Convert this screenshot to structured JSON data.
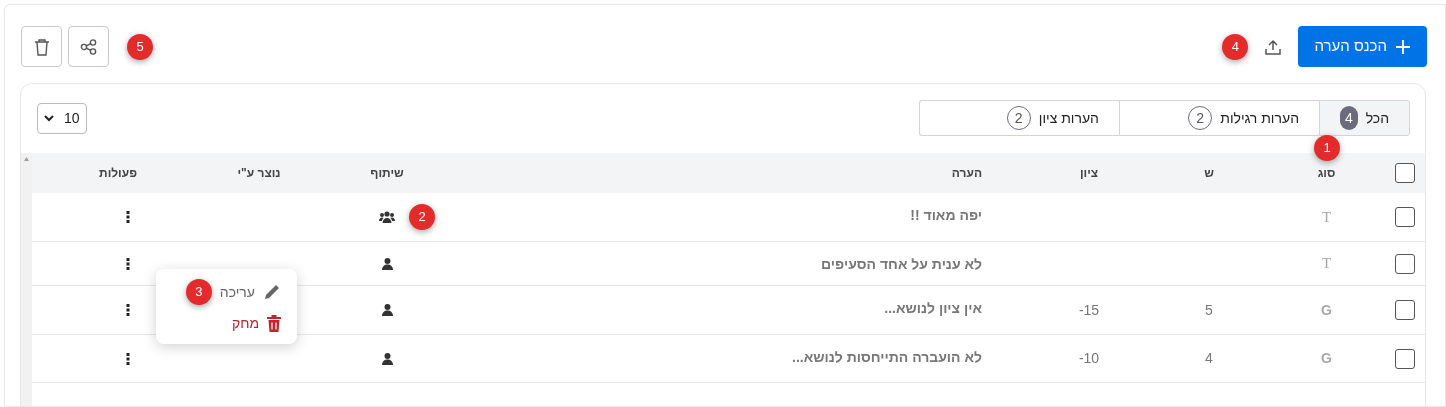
{
  "toolbar": {
    "new_button": "הכנס הערה",
    "upload_callout": "4",
    "icon_buttons_callout": "5"
  },
  "tabs": [
    {
      "label": "הכל",
      "count": "4",
      "selected": true,
      "callout": "1"
    },
    {
      "label": "הערות רגילות",
      "count": "2",
      "selected": false
    },
    {
      "label": "הערות ציון",
      "count": "2",
      "selected": false
    }
  ],
  "page_size": {
    "value": "10"
  },
  "table": {
    "columns": [
      "סוג",
      "ש",
      "ציון",
      "הערה",
      "שיתוף",
      "נוצר ע\"י",
      "פעולות"
    ],
    "header_checked": false,
    "rows": [
      {
        "checked": false,
        "kind": "text",
        "type_letter": "T",
        "note": "יפה מאוד !!",
        "shared_with_group": true,
        "sharing_callout": "2"
      },
      {
        "checked": false,
        "kind": "text",
        "type_letter": "T",
        "note": "לא ענית על אחד הסעיפים",
        "shared_with_group": false
      },
      {
        "checked": false,
        "kind": "grade",
        "type_letter": "G",
        "s": "5",
        "grade": "-15",
        "note": "אין ציון לנושא...",
        "shared_with_group": false
      },
      {
        "checked": false,
        "kind": "grade",
        "type_letter": "G",
        "s": "4",
        "grade": "-10",
        "note": "לא הועברה התייחסות לנושא...",
        "shared_with_group": false
      }
    ]
  },
  "row_menu": {
    "callout": "3",
    "items": [
      {
        "kind": "edit",
        "label": "עריכה"
      },
      {
        "kind": "delete",
        "label": "מחק"
      }
    ]
  }
}
